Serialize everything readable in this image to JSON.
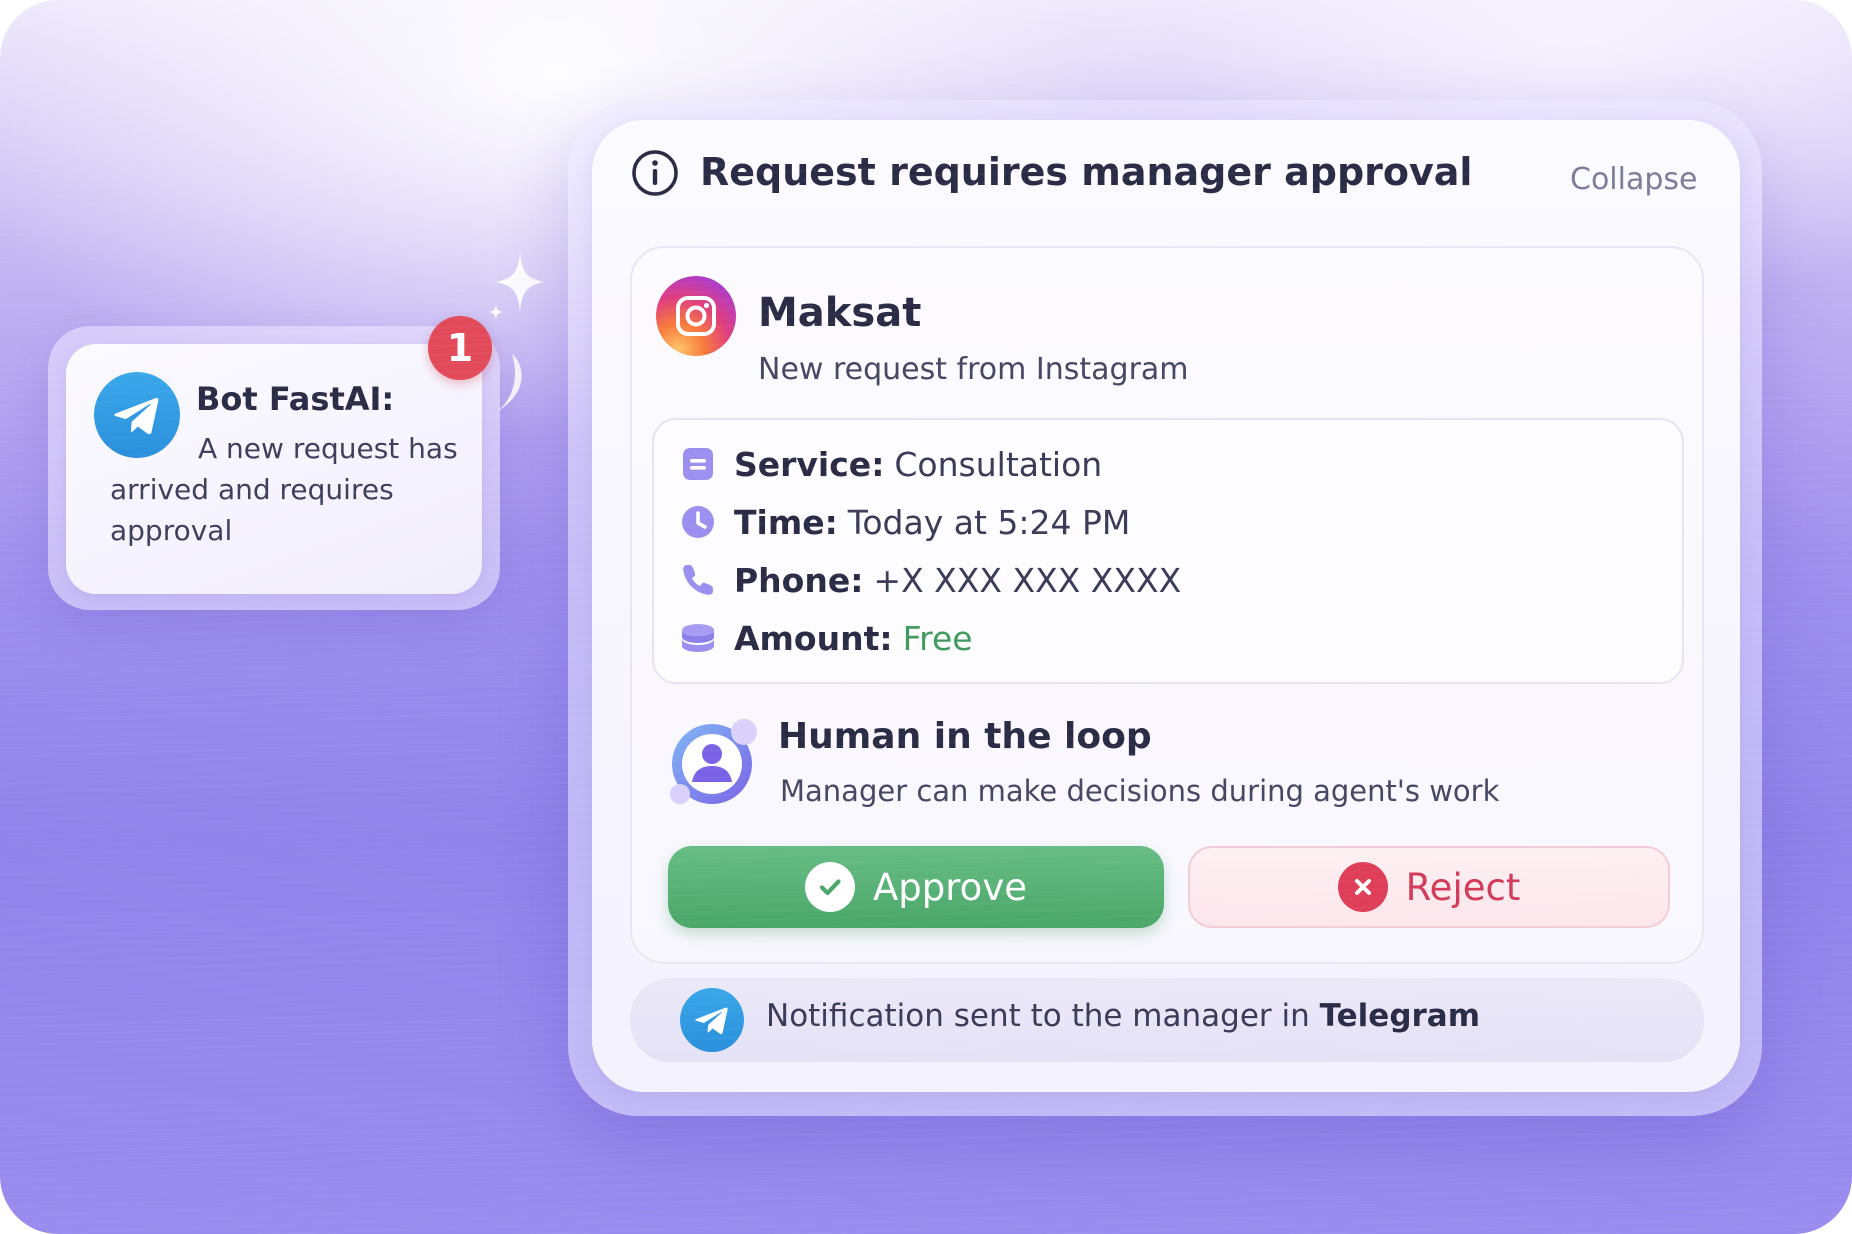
{
  "notification": {
    "sender": "Bot FastAI:",
    "message": "A new request has arrived and requires approval",
    "badge_count": "1",
    "icon": "telegram-icon"
  },
  "panel": {
    "title": "Request requires manager approval",
    "collapse_label": "Collapse",
    "info_icon": "info-icon"
  },
  "client": {
    "name": "Maksat",
    "subtitle": "New request from Instagram",
    "icon": "instagram-icon"
  },
  "details": [
    {
      "label": "Service:",
      "value": "Consultation",
      "icon": "document-icon"
    },
    {
      "label": "Time:",
      "value": "Today at 5:24 PM",
      "icon": "clock-icon"
    },
    {
      "label": "Phone:",
      "value": "+X XXX XXX XXXX",
      "icon": "phone-icon"
    },
    {
      "label": "Amount:",
      "value": "Free",
      "icon": "coins-icon"
    }
  ],
  "hitl": {
    "title": "Human in the loop",
    "subtitle": "Manager can make decisions during agent's work",
    "icon": "user-loop-icon"
  },
  "actions": {
    "approve_label": "Approve",
    "reject_label": "Reject"
  },
  "footer": {
    "text_prefix": "Notification sent to the manager in",
    "channel": "Telegram"
  },
  "colors": {
    "approve": "#4aa669",
    "reject": "#d33b58",
    "badge": "#e24a5a",
    "telegram": "#2a8fdb",
    "free": "#3f9a5e"
  }
}
